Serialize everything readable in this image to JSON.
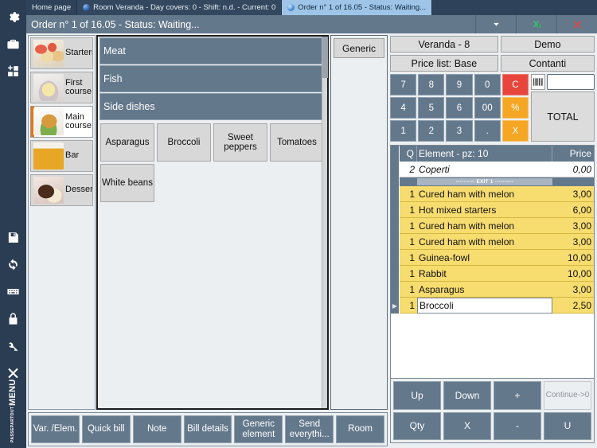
{
  "tabs": [
    {
      "label": "Home page",
      "icon": null,
      "active": false
    },
    {
      "label": "Room Veranda - Day covers: 0 - Shift: n.d. - Current: 0",
      "icon": "globe-icon",
      "active": false
    },
    {
      "label": "Order n° 1 of 16.05 - Status: Waiting...",
      "icon": "globe-icon",
      "active": true
    }
  ],
  "titlebar": {
    "title": "Order n° 1 of 16.05 - Status: Waiting...",
    "buttons": [
      {
        "name": "chevron-down-icon",
        "label": ""
      },
      {
        "name": "export-excel-icon",
        "label": ""
      },
      {
        "name": "close-icon",
        "label": ""
      }
    ]
  },
  "rail": {
    "top_icons": [
      {
        "name": "gear-icon"
      },
      {
        "name": "briefcase-icon"
      },
      {
        "name": "add-grid-icon"
      }
    ],
    "bottom_icons": [
      {
        "name": "save-icon"
      },
      {
        "name": "refresh-icon"
      },
      {
        "name": "keyboard-icon"
      },
      {
        "name": "lock-icon"
      },
      {
        "name": "key-icon"
      },
      {
        "name": "close-x-icon"
      }
    ],
    "brand": {
      "line1": "PASSEPARTOUT",
      "line2": "MENU",
      "logo": "fork-logo-icon"
    }
  },
  "categories": [
    {
      "label": "Starters",
      "thumb": "th-starters",
      "active": false
    },
    {
      "label": "First course",
      "thumb": "th-first",
      "active": false
    },
    {
      "label": "Main course",
      "thumb": "th-main",
      "active": true
    },
    {
      "label": "Bar",
      "thumb": "th-bar",
      "active": false
    },
    {
      "label": "Desserts",
      "thumb": "th-desserts",
      "active": false
    }
  ],
  "groups": [
    "Meat",
    "Fish",
    "Side dishes"
  ],
  "items": [
    "Asparagus",
    "Broccoli",
    "Sweet peppers",
    "Tomatoes",
    "White beans"
  ],
  "generic": {
    "button_label": "Generic"
  },
  "bottom_toolbar": [
    "Var. /Elem.",
    "Quick bill",
    "Note",
    "Bill details",
    "Generic element",
    "Send everythi...",
    "Room"
  ],
  "right": {
    "header_buttons": [
      {
        "label": "Veranda - 8"
      },
      {
        "label": "Demo"
      },
      {
        "label": "Price list: Base"
      },
      {
        "label": "Contanti"
      }
    ],
    "keypad": [
      {
        "label": "7",
        "style": "normal"
      },
      {
        "label": "8",
        "style": "normal"
      },
      {
        "label": "9",
        "style": "normal"
      },
      {
        "label": "0",
        "style": "normal"
      },
      {
        "label": "C",
        "style": "red"
      },
      {
        "label": "4",
        "style": "normal"
      },
      {
        "label": "5",
        "style": "normal"
      },
      {
        "label": "6",
        "style": "normal"
      },
      {
        "label": "00",
        "style": "normal"
      },
      {
        "label": "%",
        "style": "orange"
      },
      {
        "label": "1",
        "style": "normal"
      },
      {
        "label": "2",
        "style": "normal"
      },
      {
        "label": "3",
        "style": "normal"
      },
      {
        "label": ".",
        "style": "normal"
      },
      {
        "label": "X",
        "style": "orange"
      }
    ],
    "barcode": {
      "icon": "barcode-icon",
      "value": ""
    },
    "total_label": "TOTAL",
    "grid": {
      "headers": {
        "mark": "",
        "qty": "Q",
        "element": "Element - pz: 10",
        "price": "Price"
      },
      "rows": [
        {
          "type": "cover",
          "qty": "2",
          "element": "Coperti",
          "price": "0,00",
          "selected": false
        },
        {
          "type": "exit",
          "qty": "",
          "element": "---------- EXIT 1 ----------",
          "price": "",
          "selected": false
        },
        {
          "type": "item",
          "qty": "1",
          "element": "Cured ham with melon",
          "price": "3,00",
          "selected": false
        },
        {
          "type": "item",
          "qty": "1",
          "element": "Hot mixed starters",
          "price": "6,00",
          "selected": false
        },
        {
          "type": "item",
          "qty": "1",
          "element": "Cured ham with melon",
          "price": "3,00",
          "selected": false
        },
        {
          "type": "item",
          "qty": "1",
          "element": "Cured ham with melon",
          "price": "3,00",
          "selected": false
        },
        {
          "type": "item",
          "qty": "1",
          "element": "Guinea-fowl",
          "price": "10,00",
          "selected": false
        },
        {
          "type": "item",
          "qty": "1",
          "element": "Rabbit",
          "price": "10,00",
          "selected": false
        },
        {
          "type": "item",
          "qty": "1",
          "element": "Asparagus",
          "price": "3,00",
          "selected": false
        },
        {
          "type": "item",
          "qty": "1",
          "element": "Broccoli",
          "price": "2,50",
          "selected": true
        }
      ]
    },
    "actions": [
      {
        "label": "Up",
        "disabled": false
      },
      {
        "label": "Down",
        "disabled": false
      },
      {
        "label": "+",
        "disabled": false
      },
      {
        "label": "Continue->0",
        "disabled": true
      },
      {
        "label": "Qty",
        "disabled": false
      },
      {
        "label": "X",
        "disabled": false
      },
      {
        "label": "-",
        "disabled": false
      },
      {
        "label": "U",
        "disabled": false
      }
    ]
  },
  "colors": {
    "chrome_dark": "#2b3d52",
    "titlebar": "#64788c",
    "accent_orange": "#e8750e",
    "row_yellow": "#f7dc6f",
    "key_red": "#e8453c",
    "key_orange": "#f5a623",
    "tab_active": "#9ec5e8"
  }
}
